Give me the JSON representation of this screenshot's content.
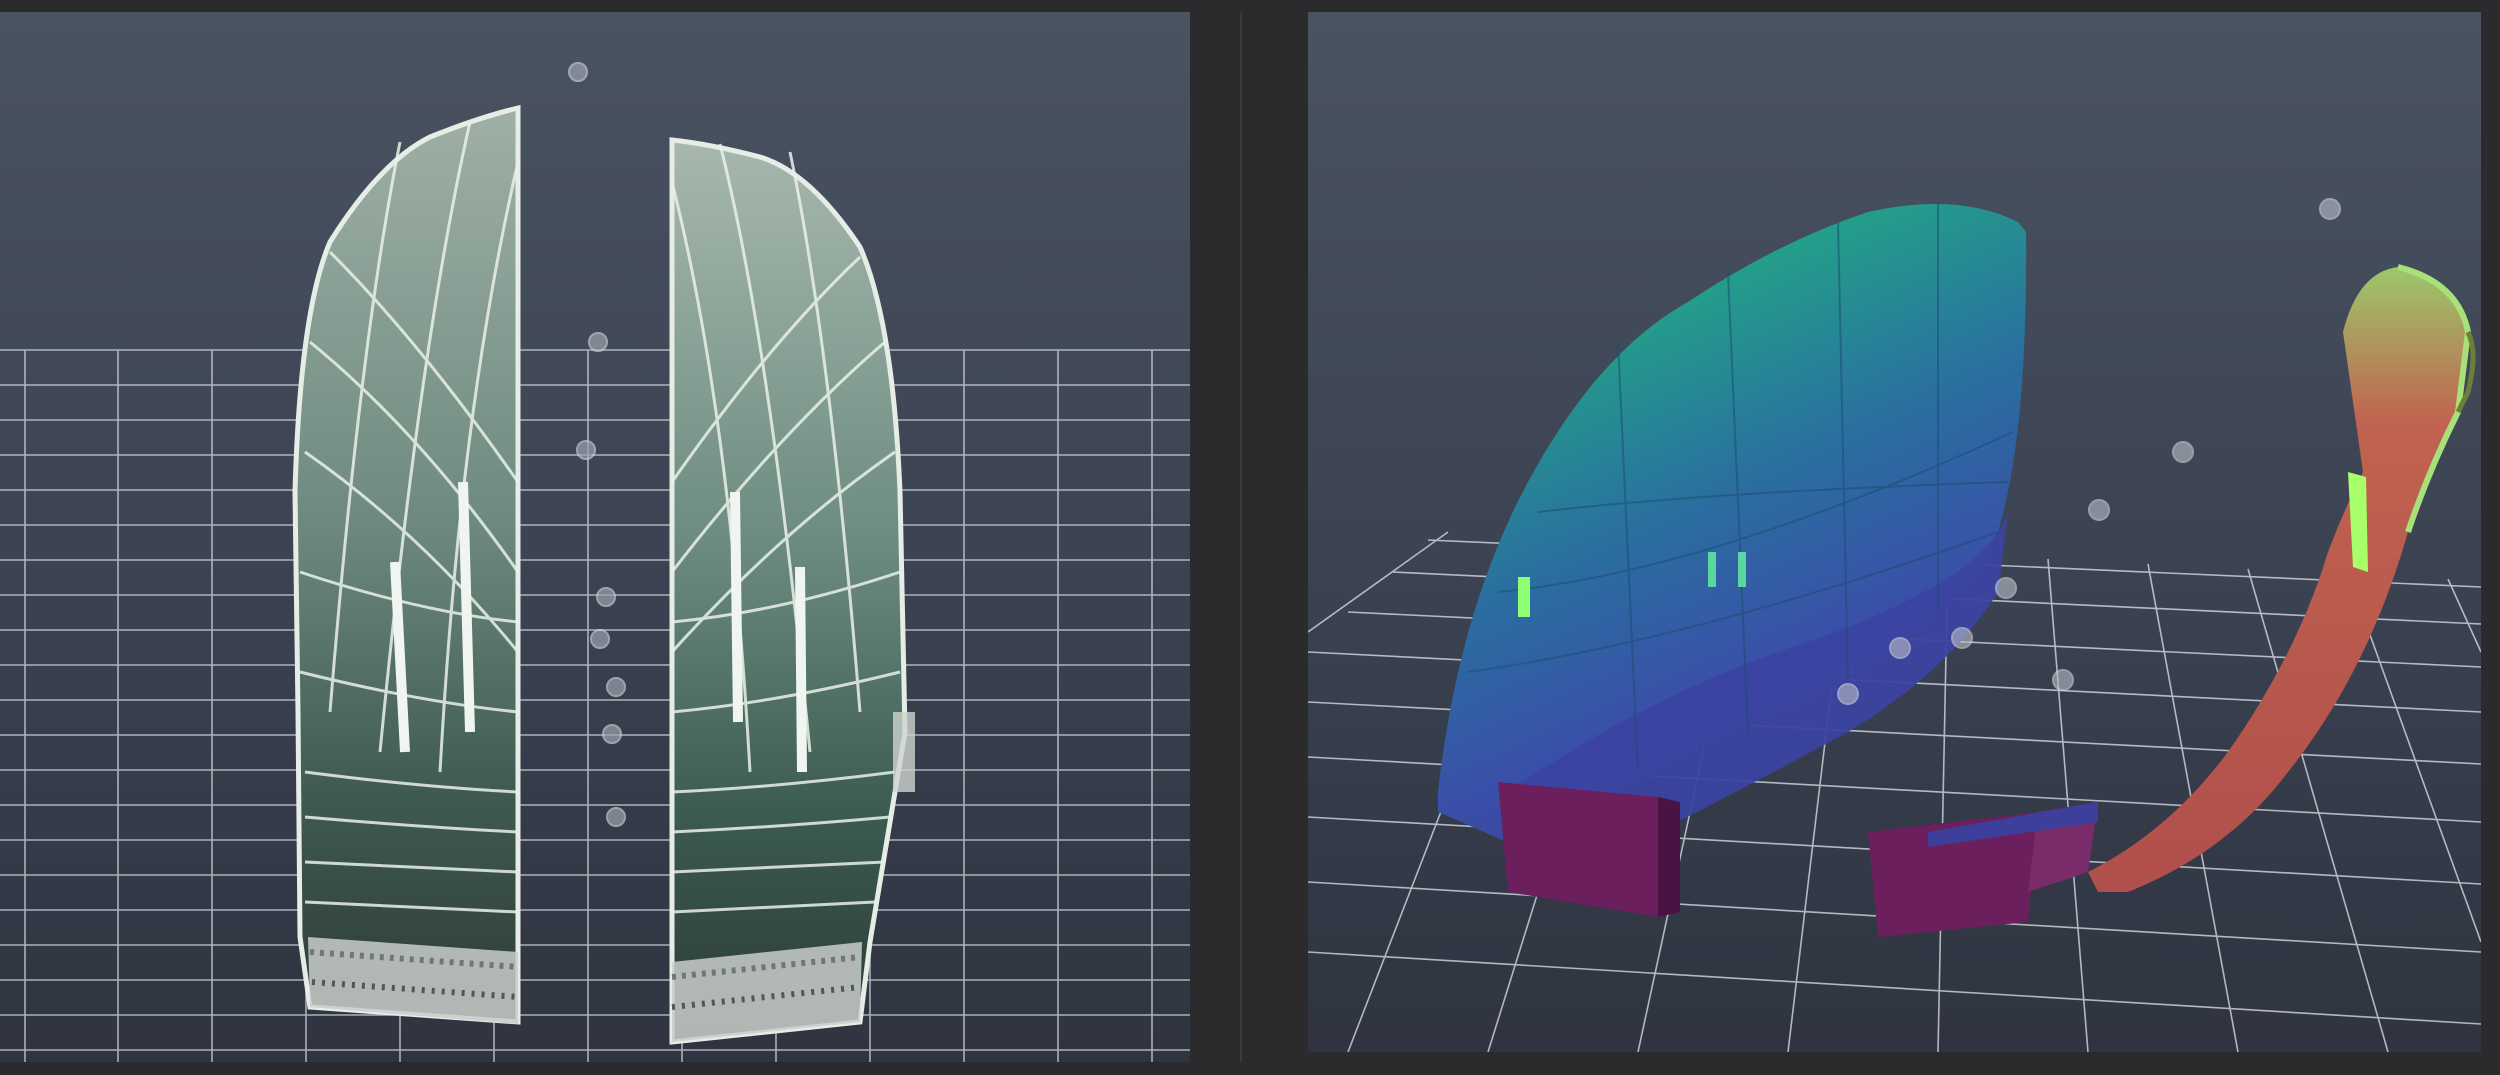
{
  "app": {
    "name": "",
    "colors": {
      "background": "#2b2b2d",
      "viewport_top": "#4a5362",
      "viewport_bottom": "#2f3440",
      "grid": "#d9dde4",
      "scan_fill": "#5f7a73",
      "scan_highlight": "#e8efe9",
      "mesh_green": "#3fbf6a",
      "mesh_teal": "#1f8c86",
      "mesh_blue": "#3a4fa8",
      "mesh_red": "#b5524a",
      "mesh_purple": "#6b1f5c"
    }
  },
  "views": [
    {
      "name": "left-viewport",
      "content": "point-cloud",
      "grid": true
    },
    {
      "name": "right-viewport",
      "content": "color-mesh",
      "grid": true
    }
  ]
}
